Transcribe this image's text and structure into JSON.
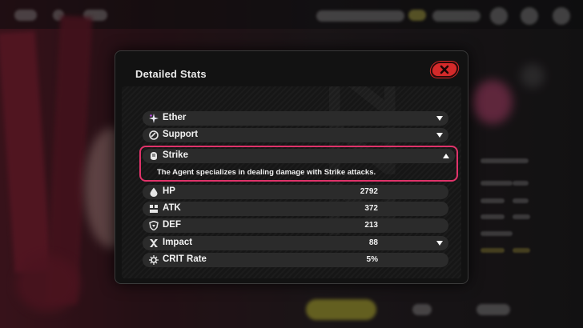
{
  "background": {
    "accent_pink": "#8a2438",
    "button_yellow": "#c9c23a"
  },
  "modal": {
    "title": "Detailed Stats",
    "close_icon": "close-icon",
    "highlight_color": "#e0336a",
    "rows": [
      {
        "label": "Ether",
        "icon": "ether-icon",
        "value": "",
        "caret": "down"
      },
      {
        "label": "Support",
        "icon": "support-icon",
        "value": "",
        "caret": "down"
      },
      {
        "label": "Strike",
        "icon": "strike-icon",
        "value": "",
        "caret": "up",
        "description": "The Agent specializes in dealing damage with Strike attacks."
      },
      {
        "label": "HP",
        "icon": "hp-icon",
        "value": "2792",
        "caret": ""
      },
      {
        "label": "ATK",
        "icon": "atk-icon",
        "value": "372",
        "caret": ""
      },
      {
        "label": "DEF",
        "icon": "def-icon",
        "value": "213",
        "caret": ""
      },
      {
        "label": "Impact",
        "icon": "impact-icon",
        "value": "88",
        "caret": "down"
      },
      {
        "label": "CRIT Rate",
        "icon": "crit-rate-icon",
        "value": "5%",
        "caret": ""
      }
    ]
  }
}
